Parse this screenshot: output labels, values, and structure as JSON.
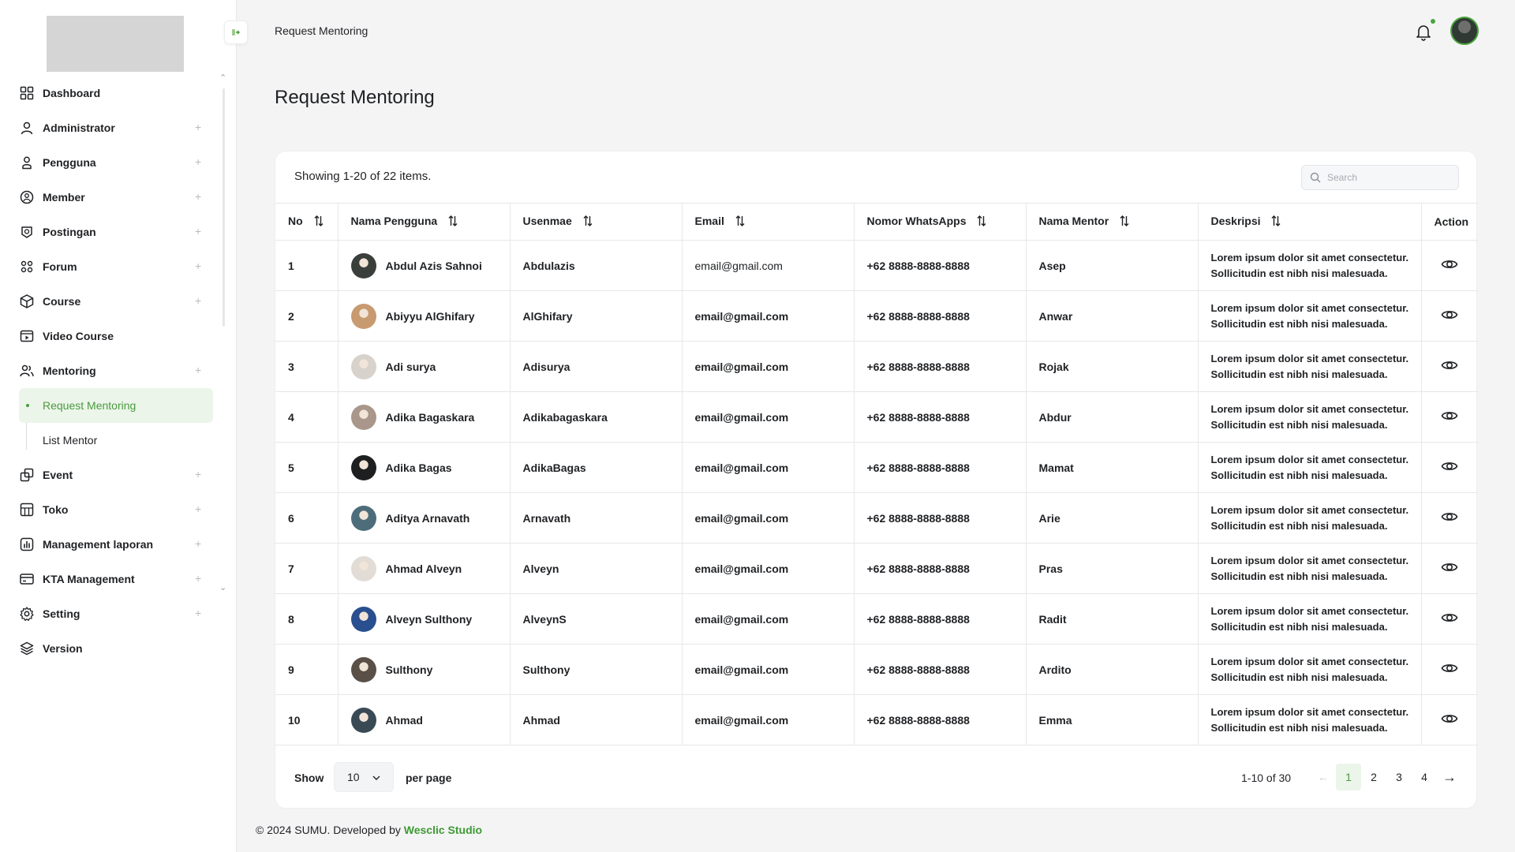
{
  "sidebar": {
    "items": [
      {
        "label": "Dashboard",
        "icon": "grid-icon",
        "expandable": false
      },
      {
        "label": "Administrator",
        "icon": "user-icon",
        "expandable": true
      },
      {
        "label": "Pengguna",
        "icon": "person-icon",
        "expandable": true
      },
      {
        "label": "Member",
        "icon": "member-badge-icon",
        "expandable": true
      },
      {
        "label": "Postingan",
        "icon": "post-icon",
        "expandable": true
      },
      {
        "label": "Forum",
        "icon": "forum-icon",
        "expandable": true
      },
      {
        "label": "Course",
        "icon": "box-icon",
        "expandable": true
      }
    ],
    "video_course": "Video Course",
    "mentoring": "Mentoring",
    "sub": {
      "request": "Request Mentoring",
      "list": "List Mentor"
    },
    "items_after": [
      {
        "label": "Event",
        "icon": "event-icon",
        "expandable": true
      },
      {
        "label": "Toko",
        "icon": "store-icon",
        "expandable": true
      },
      {
        "label": "Management laporan",
        "icon": "report-icon",
        "expandable": true
      },
      {
        "label": "KTA Management",
        "icon": "card-icon",
        "expandable": true
      },
      {
        "label": "Setting",
        "icon": "gear-icon",
        "expandable": true
      },
      {
        "label": "Version",
        "icon": "layers-icon",
        "expandable": false
      }
    ]
  },
  "header": {
    "breadcrumb": "Request Mentoring"
  },
  "page": {
    "title": "Request Mentoring"
  },
  "table": {
    "showing": "Showing 1-20 of 22 items.",
    "search_placeholder": "Search",
    "columns": [
      "No",
      "Nama Pengguna",
      "Usenmae",
      "Email",
      "Nomor WhatsApps",
      "Nama Mentor",
      "Deskripsi",
      "Action"
    ],
    "rows": [
      {
        "no": "1",
        "name": "Abdul Azis Sahnoi",
        "username": "Abdulazis",
        "email": "email@gmail.com",
        "phone": "+62 8888-8888-8888",
        "mentor": "Asep",
        "desc1": "Lorem ipsum dolor sit amet consectetur.",
        "desc2": "Sollicitudin est nibh nisi malesuada.",
        "avatar": "#3b3f3c"
      },
      {
        "no": "2",
        "name": "Abiyyu AlGhifary",
        "username": "AlGhifary",
        "email": "email@gmail.com",
        "phone": "+62 8888-8888-8888",
        "mentor": "Anwar",
        "desc1": "Lorem ipsum dolor sit amet consectetur.",
        "desc2": "Sollicitudin est nibh nisi malesuada.",
        "avatar": "#c89a6f"
      },
      {
        "no": "3",
        "name": "Adi surya",
        "username": "Adisurya",
        "email": "email@gmail.com",
        "phone": "+62 8888-8888-8888",
        "mentor": "Rojak",
        "desc1": "Lorem ipsum dolor sit amet consectetur.",
        "desc2": "Sollicitudin est nibh nisi malesuada.",
        "avatar": "#d8d2cc"
      },
      {
        "no": "4",
        "name": "Adika Bagaskara",
        "username": "Adikabagaskara",
        "email": "email@gmail.com",
        "phone": "+62 8888-8888-8888",
        "mentor": "Abdur",
        "desc1": "Lorem ipsum dolor sit amet consectetur.",
        "desc2": "Sollicitudin est nibh nisi malesuada.",
        "avatar": "#a8978a"
      },
      {
        "no": "5",
        "name": "Adika Bagas",
        "username": "AdikaBagas",
        "email": "email@gmail.com",
        "phone": "+62 8888-8888-8888",
        "mentor": "Mamat",
        "desc1": "Lorem ipsum dolor sit amet consectetur.",
        "desc2": "Sollicitudin est nibh nisi malesuada.",
        "avatar": "#1e1f20"
      },
      {
        "no": "6",
        "name": "Aditya Arnavath",
        "username": "Arnavath",
        "email": "email@gmail.com",
        "phone": "+62 8888-8888-8888",
        "mentor": "Arie",
        "desc1": "Lorem ipsum dolor sit amet consectetur.",
        "desc2": "Sollicitudin est nibh nisi malesuada.",
        "avatar": "#4d6d7a"
      },
      {
        "no": "7",
        "name": "Ahmad Alveyn",
        "username": "Alveyn",
        "email": "email@gmail.com",
        "phone": "+62 8888-8888-8888",
        "mentor": "Pras",
        "desc1": "Lorem ipsum dolor sit amet consectetur.",
        "desc2": "Sollicitudin est nibh nisi malesuada.",
        "avatar": "#e2dcd6"
      },
      {
        "no": "8",
        "name": "Alveyn Sulthony",
        "username": "AlveynS",
        "email": "email@gmail.com",
        "phone": "+62 8888-8888-8888",
        "mentor": "Radit",
        "desc1": "Lorem ipsum dolor sit amet consectetur.",
        "desc2": "Sollicitudin est nibh nisi malesuada.",
        "avatar": "#2a4f8f"
      },
      {
        "no": "9",
        "name": "Sulthony",
        "username": "Sulthony",
        "email": "email@gmail.com",
        "phone": "+62 8888-8888-8888",
        "mentor": "Ardito",
        "desc1": "Lorem ipsum dolor sit amet consectetur.",
        "desc2": "Sollicitudin est nibh nisi malesuada.",
        "avatar": "#5a5048"
      },
      {
        "no": "10",
        "name": "Ahmad",
        "username": "Ahmad",
        "email": "email@gmail.com",
        "phone": "+62 8888-8888-8888",
        "mentor": "Emma",
        "desc1": "Lorem ipsum dolor sit amet consectetur.",
        "desc2": "Sollicitudin est nibh nisi malesuada.",
        "avatar": "#3a4a55"
      }
    ]
  },
  "pagination": {
    "show_label": "Show",
    "per_page_value": "10",
    "per_page_label": "per page",
    "range": "1-10 of 30",
    "pages": [
      "1",
      "2",
      "3",
      "4"
    ],
    "active_page": "1"
  },
  "footer": {
    "copyright": "© 2024 SUMU. Developed by ",
    "brand": "Wesclic Studio"
  },
  "colors": {
    "accent": "#4a9a3f",
    "accent_bg": "#ecf5ea",
    "border": "#e6e7ea"
  }
}
